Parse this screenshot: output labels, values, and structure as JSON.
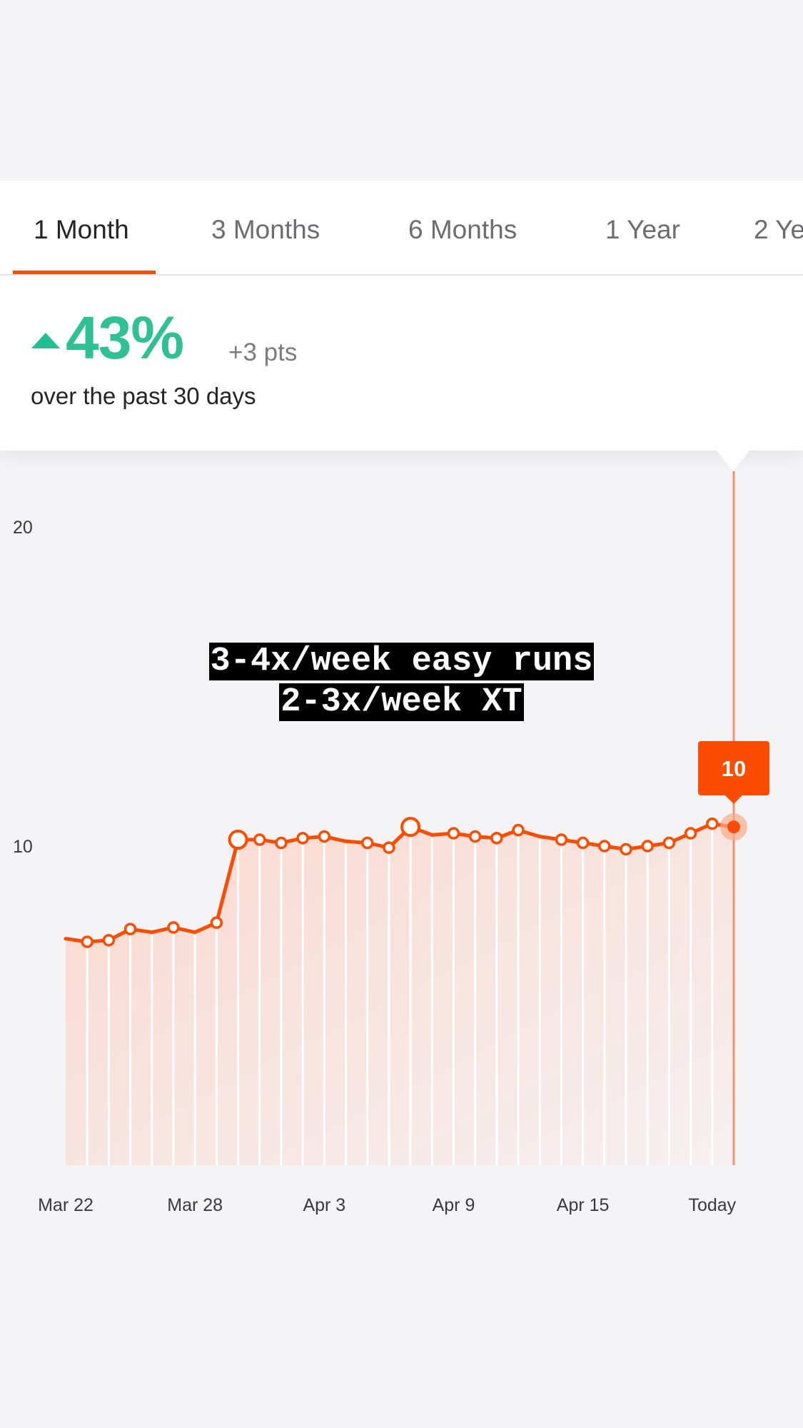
{
  "tabs": [
    {
      "label": "1 Month",
      "active": true
    },
    {
      "label": "3 Months",
      "active": false
    },
    {
      "label": "6 Months",
      "active": false
    },
    {
      "label": "1 Year",
      "active": false
    },
    {
      "label": "2 Ye",
      "active": false
    }
  ],
  "summary": {
    "trend_icon": "up-triangle-icon",
    "percent": "43%",
    "points": "+3 pts",
    "period": "over the past 30 days"
  },
  "overlay_text": {
    "line1": "3-4x/week easy runs",
    "line2": "2-3x/week XT"
  },
  "colors": {
    "accent": "#fc4c02",
    "positive": "#2ec192"
  },
  "chart_data": {
    "type": "area",
    "y_ticks": [
      "20",
      "10"
    ],
    "y_tick_values": [
      20,
      10
    ],
    "ylim": [
      0,
      21
    ],
    "x_tick_labels": [
      "Mar 22",
      "Mar 28",
      "Apr 3",
      "Apr 9",
      "Apr 15",
      "Today"
    ],
    "x_tick_indices": [
      0,
      6,
      12,
      18,
      24,
      30
    ],
    "values": [
      7.1,
      7.0,
      7.05,
      7.4,
      7.3,
      7.45,
      7.3,
      7.6,
      10.2,
      10.2,
      10.1,
      10.25,
      10.3,
      10.15,
      10.1,
      9.95,
      10.6,
      10.35,
      10.4,
      10.3,
      10.25,
      10.5,
      10.3,
      10.2,
      10.1,
      10.0,
      9.9,
      10.0,
      10.1,
      10.4,
      10.7,
      10.6
    ],
    "marked_points": [
      1,
      2,
      3,
      5,
      7,
      8,
      9,
      10,
      11,
      12,
      14,
      15,
      16,
      18,
      19,
      20,
      21,
      23,
      24,
      25,
      26,
      27,
      28,
      29,
      30
    ],
    "large_marked_points": [
      8,
      16
    ],
    "selected": {
      "label": "Today",
      "value": "10"
    },
    "grid": false
  }
}
